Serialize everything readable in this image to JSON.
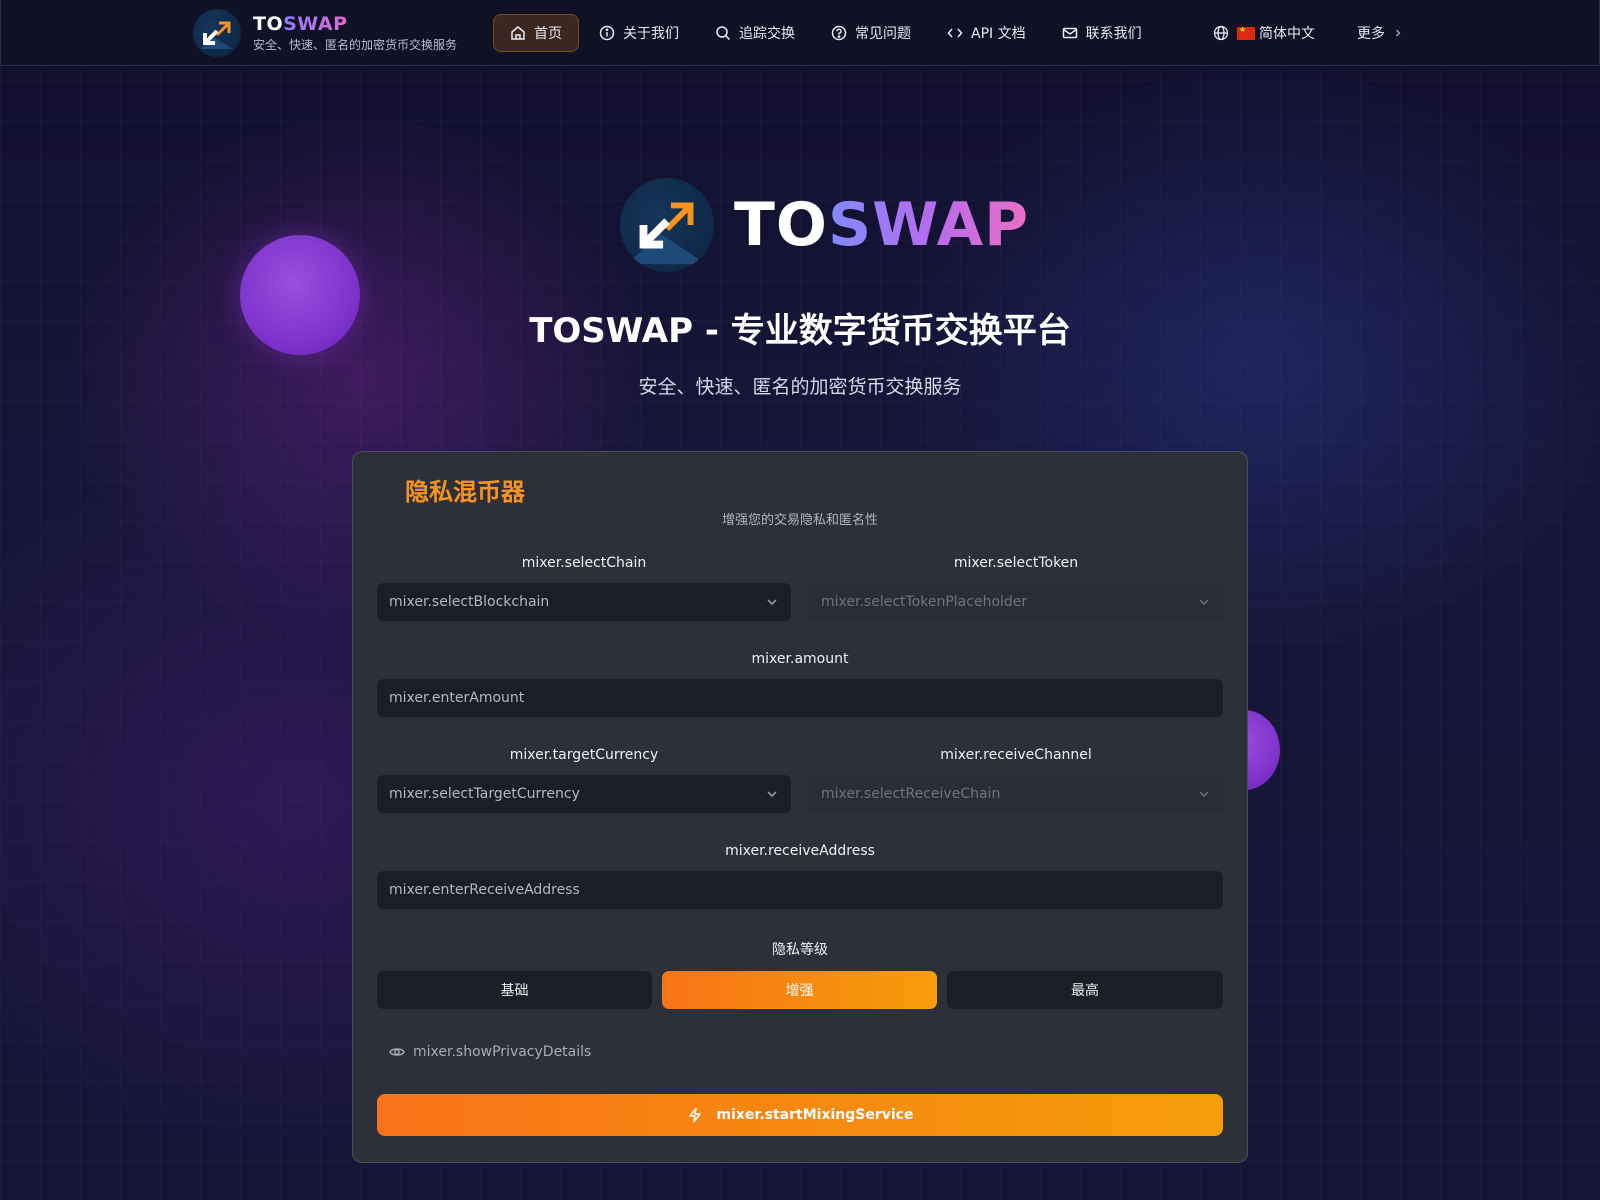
{
  "header": {
    "brand_to": "TO",
    "brand_swap": "SWAP",
    "brand_tagline": "安全、快速、匿名的加密货币交换服务",
    "nav": [
      {
        "label": "首页",
        "icon": "home-icon"
      },
      {
        "label": "关于我们",
        "icon": "info-icon"
      },
      {
        "label": "追踪交换",
        "icon": "search-icon"
      },
      {
        "label": "常见问题",
        "icon": "help-icon"
      },
      {
        "label": "API 文档",
        "icon": "code-icon"
      },
      {
        "label": "联系我们",
        "icon": "mail-icon"
      }
    ],
    "language": "简体中文",
    "more": "更多"
  },
  "hero": {
    "logo_to": "TO",
    "logo_swap": "SWAP",
    "heading": "TOSWAP - 专业数字货币交换平台",
    "subheading": "安全、快速、匿名的加密货币交换服务"
  },
  "mixer": {
    "title": "隐私混币器",
    "subtitle": "增强您的交易隐私和匿名性",
    "chain_label": "mixer.selectChain",
    "chain_placeholder": "mixer.selectBlockchain",
    "token_label": "mixer.selectToken",
    "token_placeholder": "mixer.selectTokenPlaceholder",
    "amount_label": "mixer.amount",
    "amount_placeholder": "mixer.enterAmount",
    "target_label": "mixer.targetCurrency",
    "target_placeholder": "mixer.selectTargetCurrency",
    "channel_label": "mixer.receiveChannel",
    "channel_placeholder": "mixer.selectReceiveChain",
    "address_label": "mixer.receiveAddress",
    "address_placeholder": "mixer.enterReceiveAddress",
    "privacy_label": "隐私等级",
    "levels": [
      "基础",
      "增强",
      "最高"
    ],
    "selected_level": "增强",
    "show_details": "mixer.showPrivacyDetails",
    "start_button": "mixer.startMixingService"
  },
  "colors": {
    "accent": "#f7931e",
    "brand_gradient_start": "#8a7bff",
    "brand_gradient_end": "#e76ad0"
  }
}
